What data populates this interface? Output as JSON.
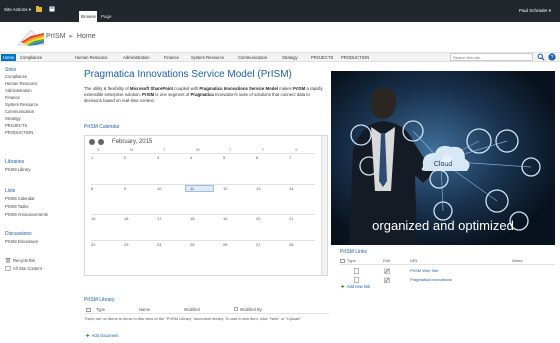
{
  "ribbon": {
    "site_actions": "Site Actions ▾",
    "tabs": [
      "Browse",
      "Page"
    ],
    "user": "Paul Schrader ▾"
  },
  "header": {
    "site_name": "PrISM",
    "breadcrumb_sep": "▸",
    "page": "Home"
  },
  "topnav": {
    "items": [
      "Home",
      "Compliance",
      "Human Resource",
      "Administration",
      "Finance",
      "System Resource",
      "Communication",
      "Strategy",
      "PROJECTS",
      "PRODUCTION"
    ],
    "search_placeholder": "Search this site..."
  },
  "leftnav": {
    "sites_heading": "Sites",
    "sites": [
      "Compliance",
      "Human Resource",
      "Administration",
      "Finance",
      "System Resource",
      "Communication",
      "Strategy",
      "PROJECTS",
      "PRODUCTION"
    ],
    "libraries_heading": "Libraries",
    "libraries": [
      "PrISM Library"
    ],
    "lists_heading": "Lists",
    "lists": [
      "PrISM Calendar",
      "PrISM Tasks",
      "PrISM Announcements"
    ],
    "discussions_heading": "Discussions",
    "discussions": [
      "PrISM Discussion"
    ],
    "recycle_bin": "Recycle Bin",
    "all_site_content": "All Site Content"
  },
  "main": {
    "title": "Pragmatica Innovations Service Model (PrISM)",
    "intro": {
      "p1": "The utility & flexibility of ",
      "b1": "Microsoft SharePoint",
      "p2": " coupled with ",
      "b2": "Pragmatica Innovations Service Model",
      "p3": " makes ",
      "b3": "PrISM",
      "p4": " a rapidly extensible enterprise solution. ",
      "b4": "PrISM",
      "p5": " is one segment of ",
      "b5": "Pragmatica",
      "p6": " Innovation's suite of solutions that connect data to decisions based on real-time context."
    }
  },
  "calendar": {
    "title": "PrISM Calendar",
    "month": "February, 2015",
    "dow": [
      "S",
      "M",
      "T",
      "W",
      "T",
      "F",
      "S"
    ],
    "weeks": [
      [
        "1",
        "2",
        "3",
        "4",
        "5",
        "6",
        "7"
      ],
      [
        "8",
        "9",
        "10",
        "11",
        "12",
        "13",
        "14"
      ],
      [
        "15",
        "16",
        "17",
        "18",
        "19",
        "20",
        "21"
      ],
      [
        "22",
        "23",
        "24",
        "25",
        "26",
        "27",
        "28"
      ]
    ],
    "today": "11"
  },
  "hero": {
    "cloud_label": "Cloud",
    "caption": "organized and optimized"
  },
  "links": {
    "title": "PrISM Links",
    "columns": [
      "Type",
      "Edit",
      "URL",
      "Notes"
    ],
    "rows": [
      {
        "url": "PrISM Web Site"
      },
      {
        "url": "Pragmatica Innovations"
      }
    ],
    "add_label": "Add new link"
  },
  "library": {
    "title": "PrISM Library",
    "columns": [
      "Type",
      "Name",
      "Modified",
      "Modified By"
    ],
    "empty_message": "There are no items to show in this view of the \"PrISM Library\" document library. To add a new item, click \"New\" or \"Upload\".",
    "add_label": "Add document"
  },
  "colors": {
    "ribbon": "#22262d",
    "accent": "#1e5fa8",
    "active_tab": "#0072c6"
  }
}
